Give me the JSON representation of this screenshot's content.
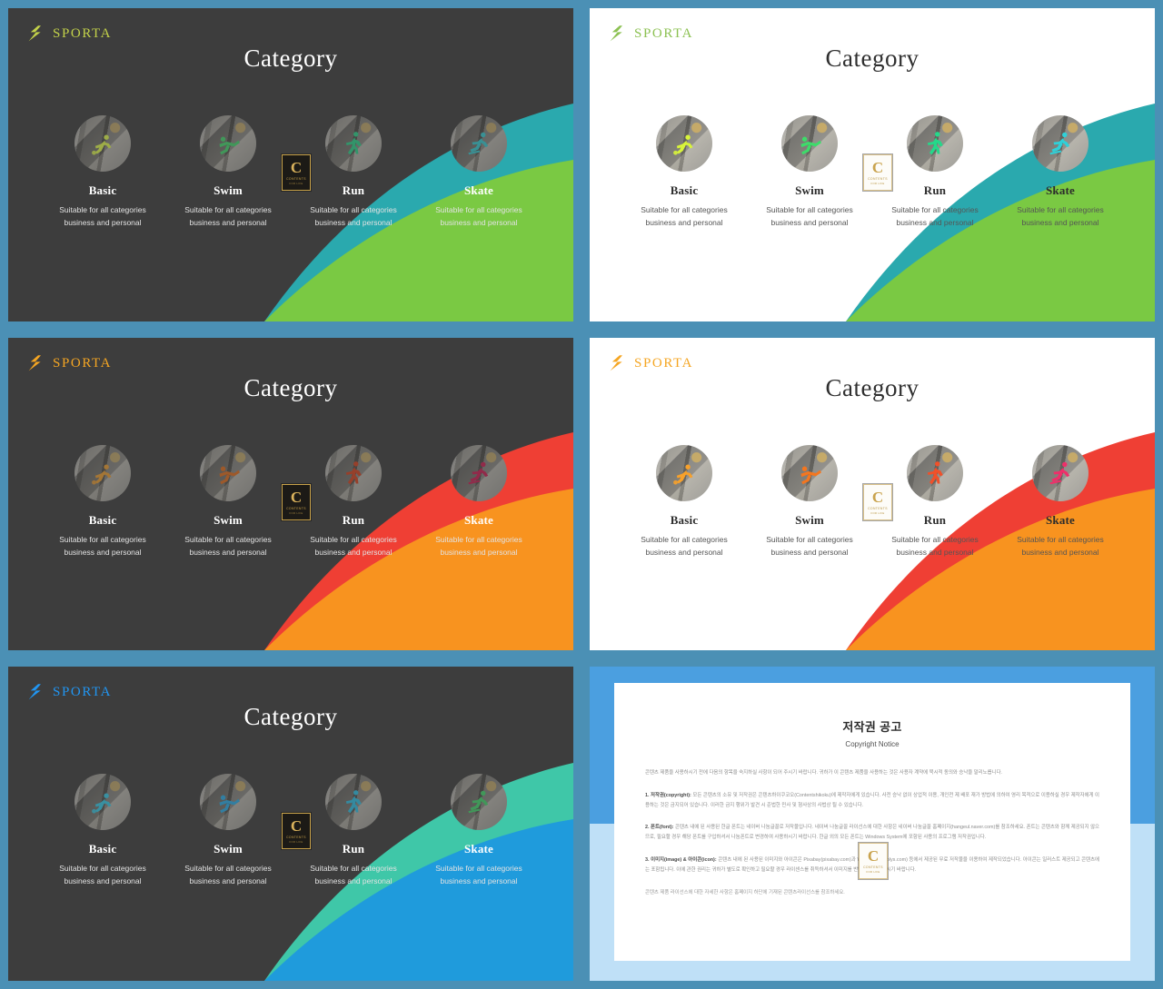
{
  "brand": {
    "name": "SPORTA",
    "mark": "bolt-icon"
  },
  "theme_colors": {
    "frame": "#4b90b5",
    "dark_bg": "#3d3d3d",
    "light_bg": "#ffffff",
    "green": "#6cbf4b",
    "teal": "#2aa9ae",
    "orange": "#f8931f",
    "red": "#ef3f34",
    "blue": "#1f9bdc",
    "mint": "#3fc7a8",
    "gold": "#d9b25c"
  },
  "slides": [
    {
      "id": "slide-1",
      "style": "dark",
      "accent": "green",
      "logo_color": "#c3d24a",
      "title": "Category",
      "wave_back": "#2aa9ae",
      "wave_front": "#7ac943",
      "items": [
        {
          "name": "Basic",
          "desc": "Suitable for all categories business and personal",
          "icon": "soccer-player-icon",
          "icon_color": "#d8f43a"
        },
        {
          "name": "Swim",
          "desc": "Suitable for all categories business and personal",
          "icon": "swimmer-icon",
          "icon_color": "#3ddc6a"
        },
        {
          "name": "Run",
          "desc": "Suitable for all categories business and personal",
          "icon": "runner-icon",
          "icon_color": "#25d88a"
        },
        {
          "name": "Skate",
          "desc": "Suitable for all categories business and personal",
          "icon": "skater-icon",
          "icon_color": "#2fd0d8"
        }
      ],
      "badge": {
        "letter": "C",
        "line1": "CONTENTS",
        "line2": "FOR  LIFE"
      }
    },
    {
      "id": "slide-2",
      "style": "light",
      "accent": "green",
      "logo_color": "#8cc152",
      "title": "Category",
      "wave_back": "#2aa9ae",
      "wave_front": "#7ac943",
      "items": [
        {
          "name": "Basic",
          "desc": "Suitable for all categories business and personal",
          "icon": "soccer-player-icon",
          "icon_color": "#d8f43a"
        },
        {
          "name": "Swim",
          "desc": "Suitable for all categories business and personal",
          "icon": "swimmer-icon",
          "icon_color": "#3ddc6a"
        },
        {
          "name": "Run",
          "desc": "Suitable for all categories business and personal",
          "icon": "runner-icon",
          "icon_color": "#25d88a"
        },
        {
          "name": "Skate",
          "desc": "Suitable for all categories business and personal",
          "icon": "skater-icon",
          "icon_color": "#2fd0d8"
        }
      ],
      "badge": {
        "letter": "C",
        "line1": "CONTENTS",
        "line2": "FOR  LIFE"
      }
    },
    {
      "id": "slide-3",
      "style": "dark",
      "accent": "orange",
      "logo_color": "#f5a623",
      "title": "Category",
      "wave_back": "#ef3f34",
      "wave_front": "#f8931f",
      "items": [
        {
          "name": "Basic",
          "desc": "Suitable for all categories business and personal",
          "icon": "soccer-player-icon",
          "icon_color": "#f7a12b"
        },
        {
          "name": "Swim",
          "desc": "Suitable for all categories business and personal",
          "icon": "swimmer-icon",
          "icon_color": "#f4761f"
        },
        {
          "name": "Run",
          "desc": "Suitable for all categories business and personal",
          "icon": "runner-icon",
          "icon_color": "#f0512a"
        },
        {
          "name": "Skate",
          "desc": "Suitable for all categories business and personal",
          "icon": "skater-icon",
          "icon_color": "#ee2f6a"
        }
      ],
      "badge": {
        "letter": "C",
        "line1": "CONTENTS",
        "line2": "FOR  LIFE"
      }
    },
    {
      "id": "slide-4",
      "style": "light",
      "accent": "orange",
      "logo_color": "#f5a623",
      "title": "Category",
      "wave_back": "#ef3f34",
      "wave_front": "#f8931f",
      "items": [
        {
          "name": "Basic",
          "desc": "Suitable for all categories business and personal",
          "icon": "soccer-player-icon",
          "icon_color": "#f7a12b"
        },
        {
          "name": "Swim",
          "desc": "Suitable for all categories business and personal",
          "icon": "swimmer-icon",
          "icon_color": "#f4761f"
        },
        {
          "name": "Run",
          "desc": "Suitable for all categories business and personal",
          "icon": "runner-icon",
          "icon_color": "#f0512a"
        },
        {
          "name": "Skate",
          "desc": "Suitable for all categories business and personal",
          "icon": "skater-icon",
          "icon_color": "#ee2f6a"
        }
      ],
      "badge": {
        "letter": "C",
        "line1": "CONTENTS",
        "line2": "FOR  LIFE"
      }
    },
    {
      "id": "slide-5",
      "style": "dark",
      "accent": "blue",
      "logo_color": "#2196f3",
      "title": "Category",
      "wave_back": "#3fc7a8",
      "wave_front": "#1f9bdc",
      "items": [
        {
          "name": "Basic",
          "desc": "Suitable for all categories business and personal",
          "icon": "soccer-player-icon",
          "icon_color": "#2fd0f0"
        },
        {
          "name": "Swim",
          "desc": "Suitable for all categories business and personal",
          "icon": "swimmer-icon",
          "icon_color": "#29b6f6"
        },
        {
          "name": "Run",
          "desc": "Suitable for all categories business and personal",
          "icon": "runner-icon",
          "icon_color": "#29c7f0"
        },
        {
          "name": "Skate",
          "desc": "Suitable for all categories business and personal",
          "icon": "skater-icon",
          "icon_color": "#3ddc6a"
        }
      ],
      "badge": {
        "letter": "C",
        "line1": "CONTENTS",
        "line2": "FOR  LIFE"
      }
    }
  ],
  "copyright": {
    "id": "slide-6",
    "title_ko": "저작권 공고",
    "title_en": "Copyright Notice",
    "paragraphs": [
      {
        "lead": "",
        "text": "콘텐츠 제품을 사용하시기 전에 다음의 항목을 숙지하실 사항이 되어 주시기 바랍니다. 귀하가 이 콘텐츠 제품을 사용하는 것은 사용자 계약에 묵시적 동의와 승낙을 말리노릅니다."
      },
      {
        "lead": "1. 저작권(copyright):",
        "text": "모든 콘텐츠의 소유 및 저작권은 콘텐츠하이쿠코오(Contentshikoku)에 제작자에게 있습니다. 사전 승낙 없이 상업적 이용, 개인전 제 배포 재가 방법에 의하여 영리 목적으로 이용하실 경우 제작자에게 이용하는 것은 금지되어 있습니다. 이러한 금지 행위가 발견 시 준법한 민사 및 형사상의 사법상 될 수 있습니다."
      },
      {
        "lead": "2. 폰트(font):",
        "text": "콘텐츠 내에 된 사용된 한글 폰트는 네이버 나눔글꼴로 저작물입니다. 네이버 나눔글꼴 라이선스에 대한 사항은 네이버 나눔글꼴 홈페이지(hangeul.naver.com)를 참조하세요. 폰트는 콘텐츠와 함께 제공되지 않으므로, 필요할 경우 해당 폰트를 구입하셔서 나눔폰트로 변경하여 사용하시기 바랍니다. 한글 외의 모든 폰트는 Windows System에 포함된 사용의 프로그램 저작권입니다."
      },
      {
        "lead": "3. 이미지(image) & 아이콘(icon):",
        "text": "콘텐츠 내에 된 사용된 이미지와 아이콘은 Pixabay(pixabay.com)과 Webolys(webolys.com) 등에서 제공된 무료 저작물을 이용하여 제작되었습니다. 아이콘는 일러스트 제공되고 콘텐츠에는 포함됩니다. 이에 관한 권리는 귀하가 별도로 확인하고 필요할 경우 라이센스를 취득하셔서 이미지를 반영하여 사용하시기 바랍니다."
      },
      {
        "lead": "",
        "text": "콘텐츠 제품 라이선스에 대한 자세한 사항은 홈페이지 하단에 기재된 콘텐츠라이선스를 참조하세요."
      }
    ],
    "badge": {
      "letter": "C",
      "line1": "CONTENTS",
      "line2": "FOR  LIFE"
    }
  }
}
